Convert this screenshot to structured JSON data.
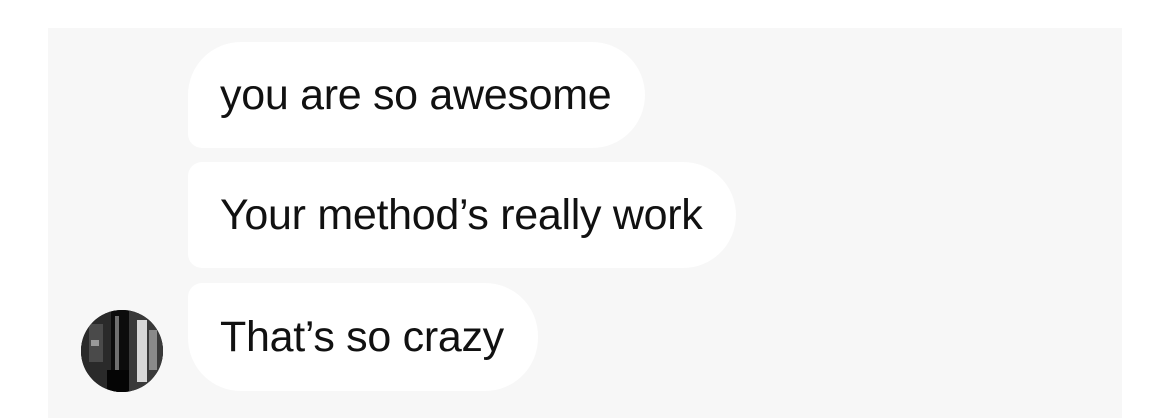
{
  "conversation": {
    "messages": [
      {
        "text": "you are so awesome"
      },
      {
        "text": "Your method’s really work"
      },
      {
        "text": "That’s so crazy"
      }
    ],
    "avatar_icon": "contact-avatar-photo"
  },
  "colors": {
    "panel_background": "#f7f7f7",
    "bubble_background": "#ffffff",
    "text": "#111111"
  }
}
